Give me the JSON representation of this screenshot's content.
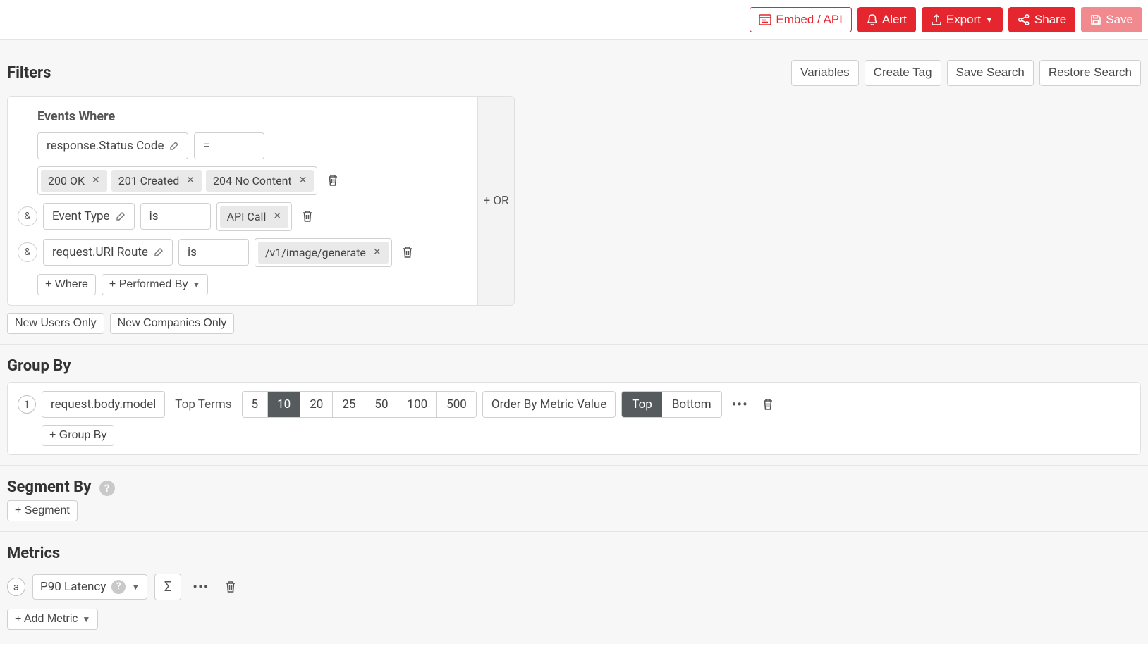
{
  "toolbar": {
    "embed_api": "Embed / API",
    "alert": "Alert",
    "export": "Export",
    "share": "Share",
    "save": "Save"
  },
  "filters": {
    "title": "Filters",
    "actions": {
      "variables": "Variables",
      "create_tag": "Create Tag",
      "save_search": "Save Search",
      "restore_search": "Restore Search"
    },
    "events_where_label": "Events Where",
    "or_label": "+ OR",
    "rows": [
      {
        "and": false,
        "field": "response.Status Code",
        "operator": "=",
        "values": [
          "200 OK",
          "201 Created",
          "204 No Content"
        ]
      },
      {
        "and": true,
        "field": "Event Type",
        "operator": "is",
        "values": [
          "API Call"
        ]
      },
      {
        "and": true,
        "field": "request.URI Route",
        "operator": "is",
        "values": [
          "/v1/image/generate"
        ]
      }
    ],
    "add_where": "+ Where",
    "add_performed_by": "+ Performed By",
    "new_users_only": "New Users Only",
    "new_companies_only": "New Companies Only"
  },
  "group_by": {
    "title": "Group By",
    "index": "1",
    "field": "request.body.model",
    "top_terms_label": "Top Terms",
    "options": [
      "5",
      "10",
      "20",
      "25",
      "50",
      "100",
      "500"
    ],
    "selected_option": "10",
    "order_by": "Order By Metric Value",
    "top": "Top",
    "bottom": "Bottom",
    "selected_dir": "Top",
    "add": "+ Group By"
  },
  "segment_by": {
    "title": "Segment By",
    "add": "+ Segment"
  },
  "metrics": {
    "title": "Metrics",
    "index": "a",
    "metric": "P90 Latency",
    "add": "+ Add Metric"
  }
}
